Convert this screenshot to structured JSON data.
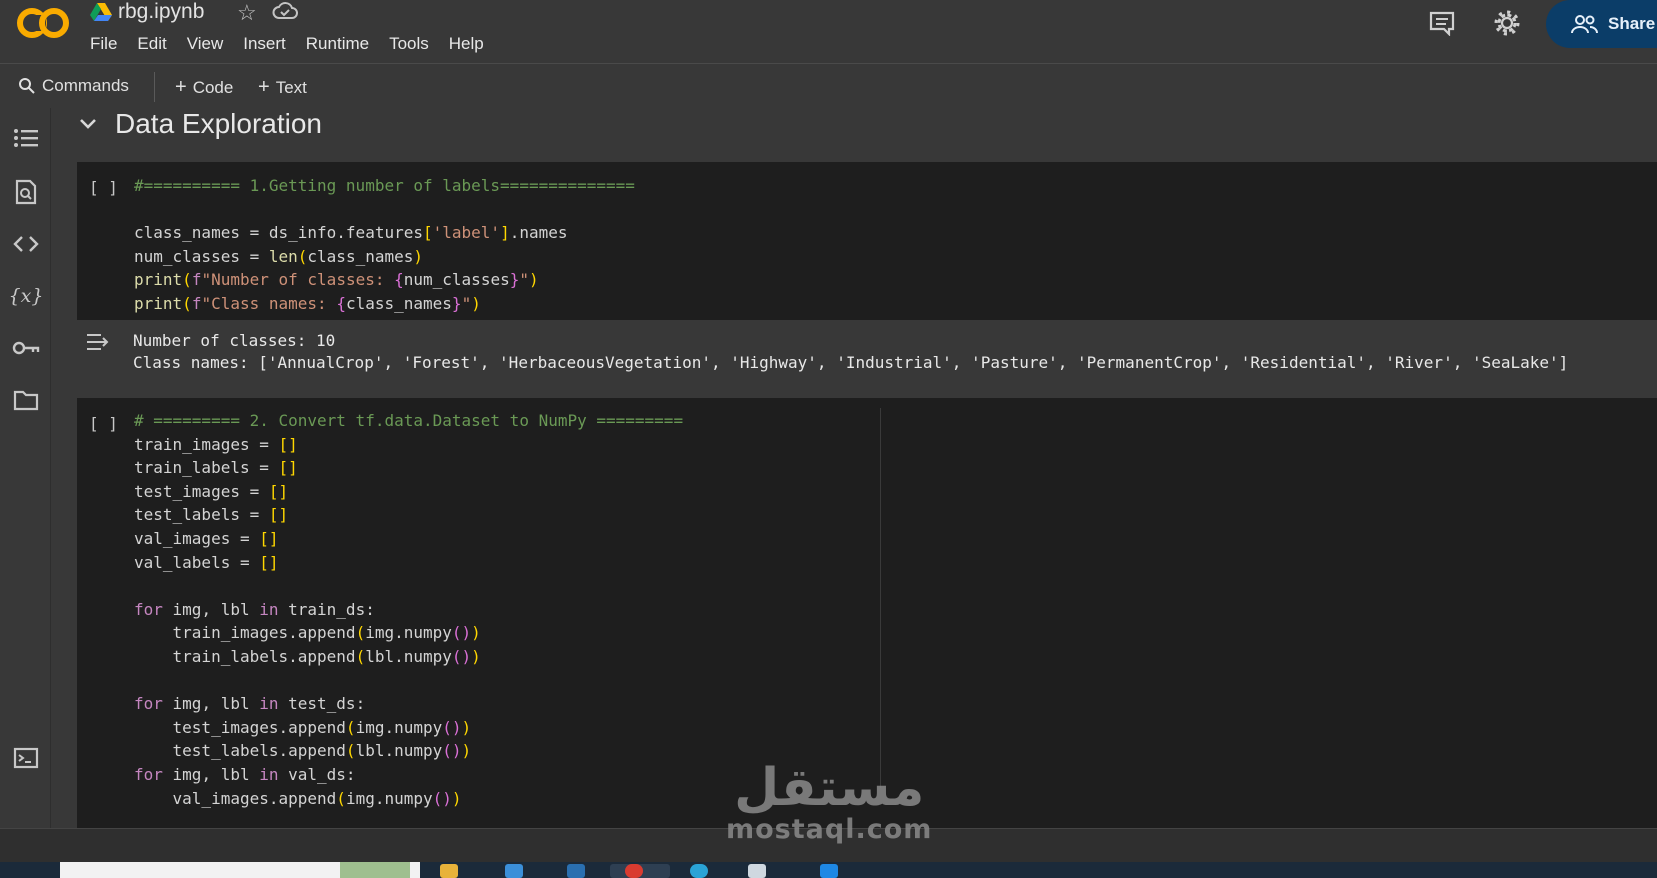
{
  "app": {
    "filename": "rbg.ipynb",
    "share_label": "Share",
    "logo_text": "CO"
  },
  "menu": [
    "File",
    "Edit",
    "View",
    "Insert",
    "Runtime",
    "Tools",
    "Help"
  ],
  "toolbar": {
    "commands_label": "Commands",
    "code_label": "Code",
    "text_label": "Text"
  },
  "section": {
    "title": "Data Exploration"
  },
  "cell1": {
    "bracket": "[ ]",
    "comment": "#========== 1.Getting number of labels=============="
  },
  "output1": {
    "line1": "Number of classes: 10",
    "line2": "Class names: ['AnnualCrop', 'Forest', 'HerbaceousVegetation', 'Highway', 'Industrial', 'Pasture', 'PermanentCrop', 'Residential', 'River', 'SeaLake']"
  },
  "cell2": {
    "bracket": "[ ]",
    "comment": "# ========= 2. Convert tf.data.Dataset to NumPy ========="
  },
  "watermark": {
    "arabic": "مستقل",
    "latin": "mostaql.com"
  },
  "colors": {
    "background": "#383838",
    "cell_bg": "#1e1e1e",
    "share_bg": "#0b3d68",
    "logo_orange": "#f9ab00"
  }
}
